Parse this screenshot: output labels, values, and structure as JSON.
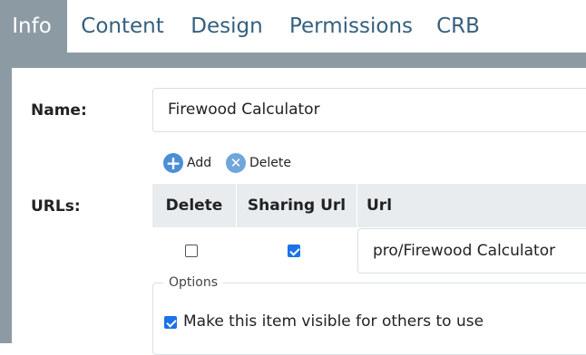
{
  "tabs": [
    {
      "label": "Info",
      "active": true
    },
    {
      "label": "Content",
      "active": false
    },
    {
      "label": "Design",
      "active": false
    },
    {
      "label": "Permissions",
      "active": false
    },
    {
      "label": "CRB",
      "active": false
    }
  ],
  "form": {
    "name_label": "Name:",
    "name_value": "Firewood Calculator",
    "urls_label": "URLs:",
    "add_label": "Add",
    "delete_label": "Delete"
  },
  "url_table": {
    "headers": [
      "Delete",
      "Sharing Url",
      "Url"
    ],
    "rows": [
      {
        "delete": false,
        "sharing": true,
        "url": "pro/Firewood Calculator"
      }
    ]
  },
  "options": {
    "legend": "Options",
    "visible_label": "Make this item visible for others to use",
    "visible_checked": true
  },
  "colors": {
    "active_tab_bg": "#8c9aa4",
    "tab_text": "#35607d",
    "checkbox_blue": "#1a73e8"
  }
}
